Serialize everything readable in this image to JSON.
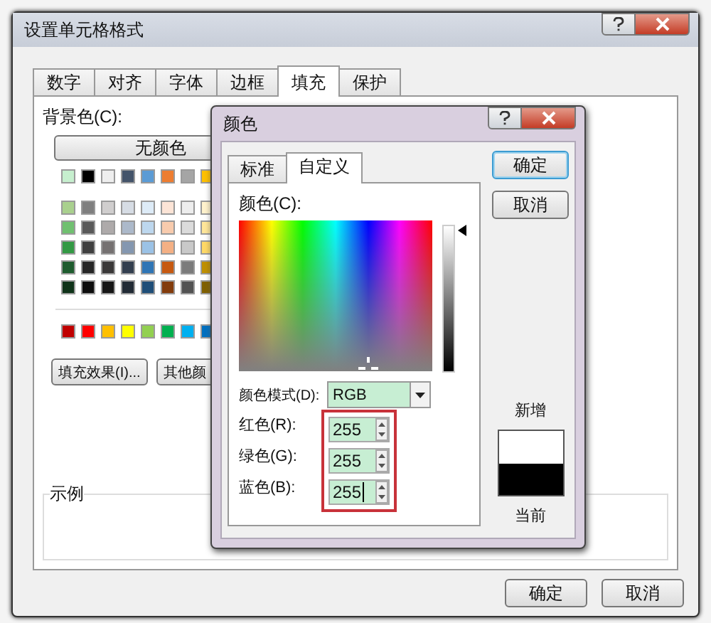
{
  "window": {
    "title": "设置单元格格式"
  },
  "tabs": [
    {
      "label": "数字",
      "selected": false
    },
    {
      "label": "对齐",
      "selected": false
    },
    {
      "label": "字体",
      "selected": false
    },
    {
      "label": "边框",
      "selected": false
    },
    {
      "label": "填充",
      "selected": true
    },
    {
      "label": "保护",
      "selected": false
    }
  ],
  "fill": {
    "background_label": "背景色(C):",
    "no_color_button": "无颜色",
    "theme_colors": [
      [
        {
          "color": "#c6efce"
        },
        {
          "color": "#000000"
        },
        {
          "color": "#eeeeee"
        },
        {
          "color": "#44546a"
        },
        {
          "color": "#5b9bd5"
        },
        {
          "color": "#ed7d31"
        },
        {
          "color": "#a5a5a5"
        },
        {
          "color": "#ffc000"
        }
      ],
      [
        {
          "color": "#a9d08e"
        },
        {
          "color": "#7f7f7f"
        },
        {
          "color": "#d0cece"
        },
        {
          "color": "#d6dce4"
        },
        {
          "color": "#ddebf7"
        },
        {
          "color": "#fce4d6"
        },
        {
          "color": "#ededed"
        },
        {
          "color": "#fff2cc"
        }
      ],
      [
        {
          "color": "#70c070"
        },
        {
          "color": "#595959"
        },
        {
          "color": "#aeaaaa"
        },
        {
          "color": "#acb9ca"
        },
        {
          "color": "#bdd7ee"
        },
        {
          "color": "#f8cbad"
        },
        {
          "color": "#dbdbdb"
        },
        {
          "color": "#ffe699"
        }
      ],
      [
        {
          "color": "#339944"
        },
        {
          "color": "#404040"
        },
        {
          "color": "#757171"
        },
        {
          "color": "#8497b0"
        },
        {
          "color": "#9bc2e6"
        },
        {
          "color": "#f4b084"
        },
        {
          "color": "#c9c9c9"
        },
        {
          "color": "#ffd966"
        }
      ],
      [
        {
          "color": "#1e5c2e"
        },
        {
          "color": "#262626"
        },
        {
          "color": "#3a3838"
        },
        {
          "color": "#333f4f"
        },
        {
          "color": "#2f75b5"
        },
        {
          "color": "#c65911"
        },
        {
          "color": "#7b7b7b"
        },
        {
          "color": "#bf8f00"
        }
      ],
      [
        {
          "color": "#0f3319"
        },
        {
          "color": "#0d0d0d"
        },
        {
          "color": "#161616"
        },
        {
          "color": "#222b35"
        },
        {
          "color": "#1f4e78"
        },
        {
          "color": "#833c0c"
        },
        {
          "color": "#525252"
        },
        {
          "color": "#806000"
        }
      ]
    ],
    "standard_colors": [
      {
        "color": "#c00000"
      },
      {
        "color": "#ff0000"
      },
      {
        "color": "#ffc000"
      },
      {
        "color": "#ffff00"
      },
      {
        "color": "#92d050"
      },
      {
        "color": "#00b050"
      },
      {
        "color": "#00b0f0"
      },
      {
        "color": "#0070c0"
      }
    ],
    "buttons": [
      "填充效果(I)...",
      "其他颜"
    ]
  },
  "sample": {
    "label": "示例"
  },
  "footer_buttons": [
    "确定",
    "取消"
  ],
  "color_dialog": {
    "title": "颜色",
    "tabs": [
      {
        "label": "标准",
        "selected": false
      },
      {
        "label": "自定义",
        "selected": true
      }
    ],
    "colors_label": "颜色(C):",
    "luminance": {
      "level": 1
    },
    "color_model": {
      "label": "颜色模式(D):",
      "value": "RGB"
    },
    "channels": [
      {
        "label": "红色(R):",
        "value": "255",
        "focused": false
      },
      {
        "label": "绿色(G):",
        "value": "255",
        "focused": false
      },
      {
        "label": "蓝色(B):",
        "value": "255",
        "focused": true
      }
    ],
    "buttons": [
      {
        "label": "确定",
        "default": true
      },
      {
        "label": "取消",
        "default": false
      }
    ],
    "preview": [
      {
        "label": "新增",
        "color": "#ffffff"
      },
      {
        "label": "当前",
        "color": "#000000"
      }
    ]
  }
}
